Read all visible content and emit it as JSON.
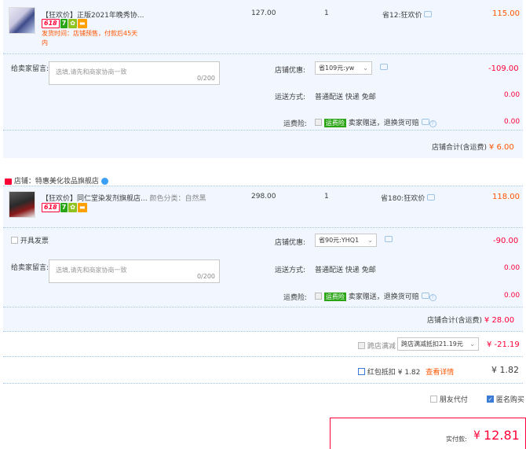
{
  "order1": {
    "title": "【狂欢价】正版2021年晚秀协...",
    "badges": [
      "618",
      "7",
      "",
      ""
    ],
    "ship_note": "发货时间：店铺预售，付款后45天内",
    "price": "127.00",
    "qty": "1",
    "discount": "省12:狂欢价",
    "subtotal": "115.00",
    "message_label": "给卖家留言:",
    "message_placeholder": "选填,请先和商家协商一致",
    "message_count": "0/200",
    "shop_discount_label": "店铺优惠:",
    "shop_discount_value": "省109元:yw",
    "shop_discount_amount": "-109.00",
    "ship_method_label": "运送方式:",
    "ship_method_value": "普通配送 快递 免邮",
    "ship_method_amount": "0.00",
    "freight_ins_label": "运费险:",
    "freight_ins_badge": "运费险",
    "freight_ins_text": "卖家赠送，退换货可赔",
    "freight_ins_amount": "0.00",
    "shop_total_label": "店铺合计(含运费)",
    "shop_total": "¥ 6.00"
  },
  "shop2": {
    "name_label": "店铺：",
    "name": "特惠美化妆品旗舰店"
  },
  "order2": {
    "title": "【狂欢价】同仁堂染发剂旗舰店...",
    "spec": "颜色分类：自然黑",
    "badges": [
      "618",
      "7",
      "",
      ""
    ],
    "price": "298.00",
    "qty": "1",
    "discount": "省180:狂欢价",
    "subtotal": "118.00",
    "invoice_label": "开具发票",
    "message_label": "给卖家留言:",
    "message_placeholder": "选填,请先和商家协商一致",
    "message_count": "0/200",
    "shop_discount_label": "店铺优惠:",
    "shop_discount_value": "省90元:YHQ1",
    "shop_discount_amount": "-90.00",
    "ship_method_label": "运送方式:",
    "ship_method_value": "普通配送 快递 免邮",
    "ship_method_amount": "0.00",
    "freight_ins_label": "运费险:",
    "freight_ins_badge": "运费险",
    "freight_ins_text": "卖家赠送，退换货可赔",
    "freight_ins_amount": "0.00",
    "shop_total_label": "店铺合计(含运费)",
    "shop_total": "¥ 28.00"
  },
  "cross_store": {
    "label": "跨店满减",
    "select_value": "跨店满减抵扣21.19元",
    "amount": "¥ -21.19"
  },
  "redpacket": {
    "label": "红包抵扣 ¥ 1.82",
    "link": "查看详情",
    "amount": "¥ 1.82"
  },
  "options": {
    "friend_pay": "朋友代付",
    "anonymous": "匿名购买"
  },
  "payment": {
    "label": "实付款:",
    "currency": "¥",
    "amount": "12.81"
  },
  "colors": {
    "accent_red": "#ff0036",
    "accent_blue": "#3a7bd5",
    "row_bg": "#f2f7ff"
  }
}
